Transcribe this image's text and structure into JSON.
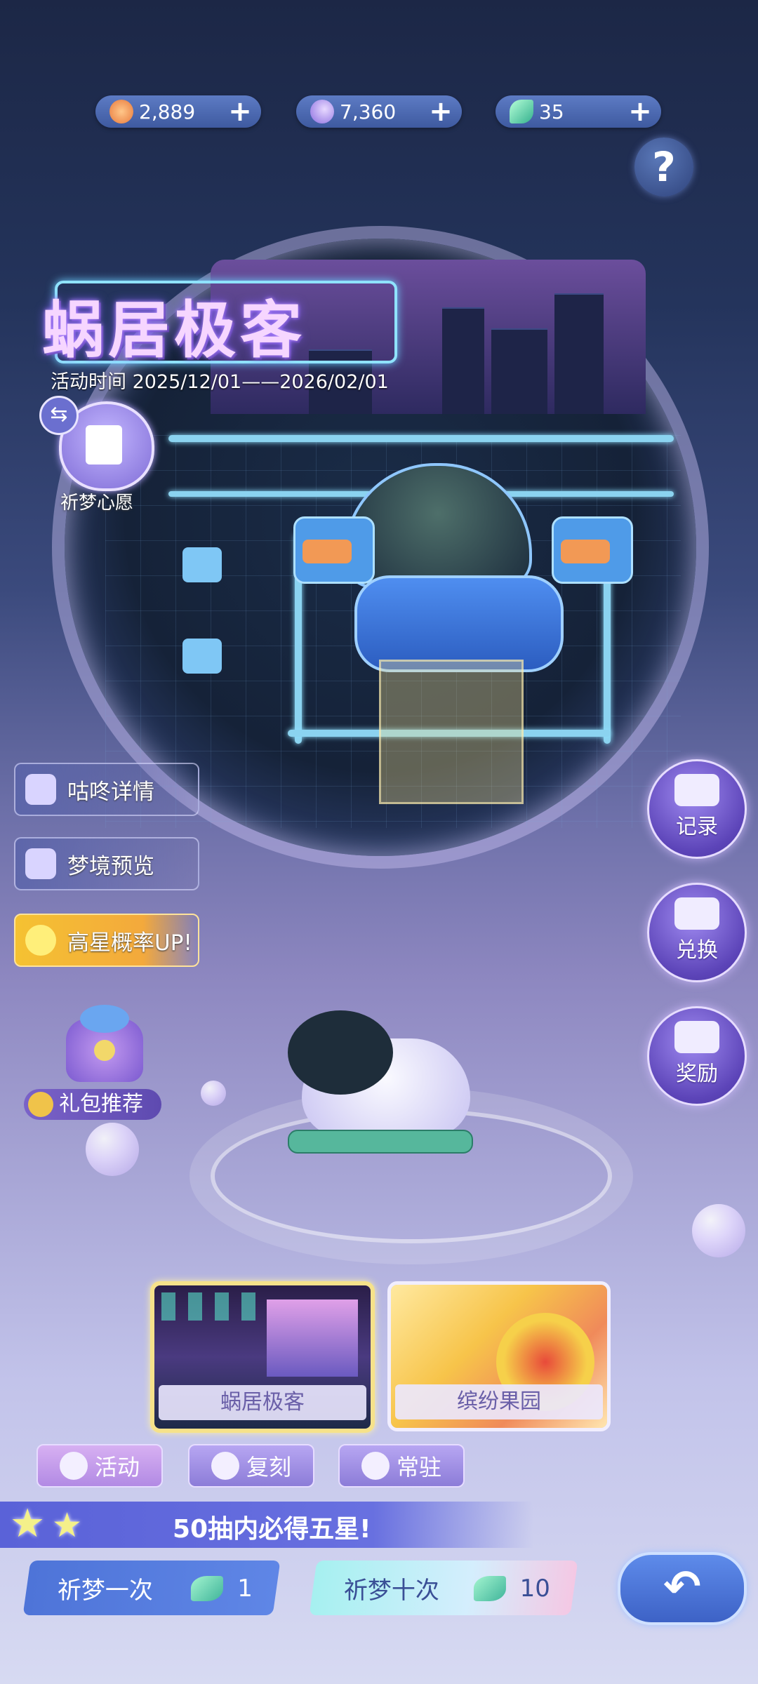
{
  "currencies": [
    {
      "icon": "sun-coin-icon",
      "value": "2,889",
      "plus": "+"
    },
    {
      "icon": "moon-crystal-icon",
      "value": "7,360",
      "plus": "+"
    },
    {
      "icon": "feather-icon",
      "value": "35",
      "plus": "+"
    }
  ],
  "help": {
    "label": "?"
  },
  "event": {
    "title": "蜗居极客",
    "time": "活动时间 2025/12/01——2026/02/01"
  },
  "wish": {
    "label": "祈梦心愿",
    "swap": "⇆"
  },
  "left_buttons": {
    "details": "咕咚详情",
    "preview": "梦境预览",
    "rate_up": "高星概率UP!"
  },
  "gift": {
    "label": "礼包推荐"
  },
  "right_buttons": {
    "record": "记录",
    "exchange": "兑换",
    "reward": "奖励"
  },
  "banners": [
    {
      "label": "蜗居极客",
      "selected": true
    },
    {
      "label": "缤纷果园",
      "selected": false
    }
  ],
  "tabs": {
    "activity": "活动",
    "rerun": "复刻",
    "standard": "常驻"
  },
  "guarantee": {
    "text": "50抽内必得五星!"
  },
  "draw": {
    "one_label": "祈梦一次",
    "one_cost": "1",
    "ten_label": "祈梦十次",
    "ten_cost": "10"
  },
  "back": {
    "label": "↶"
  },
  "colors": {
    "accent": "#5e86e6",
    "gold": "#f5c232",
    "purple": "#8c7cd8"
  }
}
